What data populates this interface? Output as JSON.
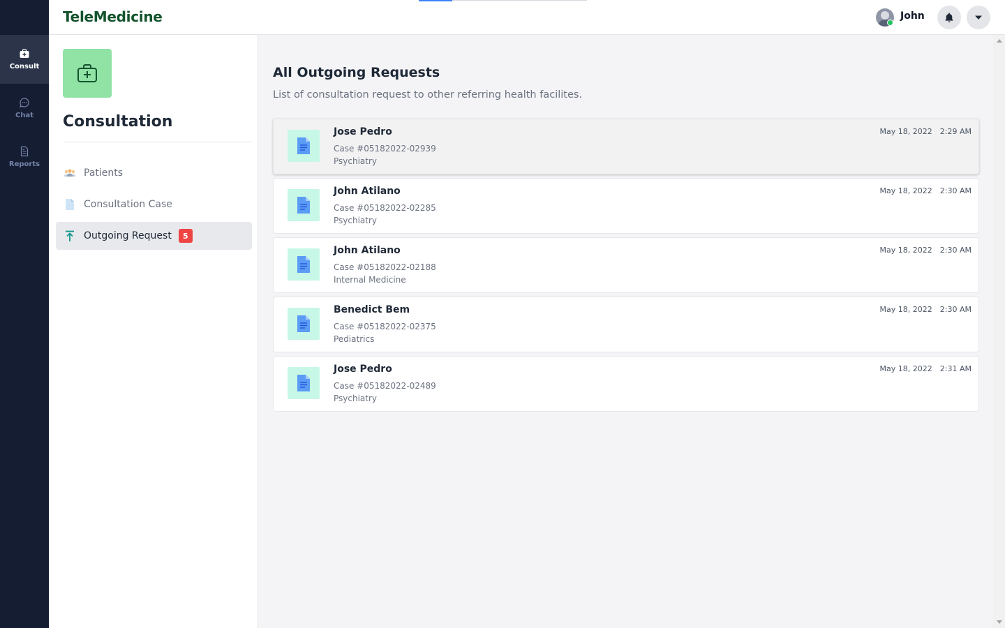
{
  "app": {
    "brand": "TeleMedicine",
    "loading_progress": 0.2
  },
  "rail": {
    "items": [
      {
        "label": "Consult",
        "icon": "medical-kit-icon",
        "active": true
      },
      {
        "label": "Chat",
        "icon": "chat-bubble-icon",
        "active": false
      },
      {
        "label": "Reports",
        "icon": "report-document-icon",
        "active": false
      }
    ]
  },
  "header": {
    "user_name": "John",
    "user_status": "online",
    "icons": [
      "bell-icon",
      "caret-down-icon"
    ]
  },
  "subnav": {
    "module_icon": "medical-kit-icon",
    "title": "Consultation",
    "items": [
      {
        "label": "Patients",
        "icon": "people-icon",
        "active": false
      },
      {
        "label": "Consultation Case",
        "icon": "document-icon",
        "active": false
      },
      {
        "label": "Outgoing Request",
        "icon": "upload-arrow-icon",
        "active": true,
        "badge": "5"
      }
    ]
  },
  "main": {
    "title": "All Outgoing Requests",
    "subtitle": "List of consultation request to other referring health facilites.",
    "requests": [
      {
        "name": "Jose Pedro",
        "case": "Case #05182022-02939",
        "specialty": "Psychiatry",
        "date": "May 18, 2022",
        "time": "2:29 AM"
      },
      {
        "name": "John Atilano",
        "case": "Case #05182022-02285",
        "specialty": "Psychiatry",
        "date": "May 18, 2022",
        "time": "2:30 AM"
      },
      {
        "name": "John Atilano",
        "case": "Case #05182022-02188",
        "specialty": "Internal Medicine",
        "date": "May 18, 2022",
        "time": "2:30 AM"
      },
      {
        "name": "Benedict Bem",
        "case": "Case #05182022-02375",
        "specialty": "Pediatrics",
        "date": "May 18, 2022",
        "time": "2:30 AM"
      },
      {
        "name": "Jose Pedro",
        "case": "Case #05182022-02489",
        "specialty": "Psychiatry",
        "date": "May 18, 2022",
        "time": "2:31 AM"
      }
    ]
  },
  "colors": {
    "rail_bg": "#151d33",
    "brand": "#14532d",
    "module_icon_bg": "#90e2a5",
    "card_icon_bg": "#c7f7e6",
    "badge": "#ef4444",
    "online": "#22c55e"
  }
}
